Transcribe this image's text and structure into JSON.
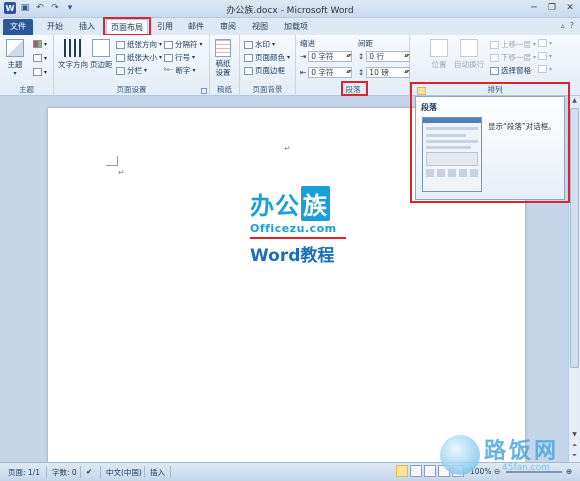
{
  "titlebar": {
    "title": "办公族.docx - Microsoft Word",
    "qat_icons": [
      "word-logo",
      "save-icon",
      "undo-icon",
      "redo-icon",
      "customize-icon"
    ],
    "window_controls": [
      "minimize",
      "restore",
      "close"
    ]
  },
  "tabs": [
    {
      "label": "文件",
      "style": "file"
    },
    {
      "label": "开始"
    },
    {
      "label": "插入"
    },
    {
      "label": "页面布局",
      "active": true,
      "highlighted": true
    },
    {
      "label": "引用"
    },
    {
      "label": "邮件"
    },
    {
      "label": "审阅"
    },
    {
      "label": "视图"
    },
    {
      "label": "加载项"
    }
  ],
  "ribbon": {
    "theme": {
      "label": "主题",
      "themes_button": "主题",
      "small_buttons": [
        "颜色",
        "字体",
        "效果"
      ]
    },
    "page_setup": {
      "label": "页面设置",
      "text_direction": "文字方向",
      "margins": "页边距",
      "orientation": "纸张方向",
      "size": "纸张大小",
      "columns": "分栏",
      "breaks": "分隔符",
      "line_numbers": "行号",
      "hyphenation": "断字"
    },
    "manuscript": {
      "label": "稿纸",
      "button": "稿纸\n设置"
    },
    "page_background": {
      "label": "页面背景",
      "watermark": "水印",
      "page_color": "页面颜色",
      "page_borders": "页面边框"
    },
    "paragraph": {
      "label": "段落",
      "indent_header": "缩进",
      "indent_left": "0 字符",
      "indent_right": "0 字符",
      "spacing_header": "间距",
      "spacing_before": "0 行",
      "spacing_after": "10 磅"
    },
    "arrange": {
      "label": "排列",
      "position": "位置",
      "wrap_text": "自动换行",
      "bring_forward": "上移一层",
      "send_backward": "下移一层",
      "selection_pane": "选择窗格"
    }
  },
  "tooltip": {
    "title": "段落",
    "description": "显示“段落”对话框。"
  },
  "document": {
    "logo_cn": "办公",
    "logo_cn_boxed": "族",
    "logo_url": "Officezu.com",
    "logo_word": "Word教程",
    "paragraph_mark": "↵"
  },
  "statusbar": {
    "page": "页面: 1/1",
    "words": "字数: 0",
    "language": "中文(中国)",
    "mode": "插入",
    "zoom": "100%"
  },
  "watermark_site": {
    "text": "路饭网",
    "url": "45fan.com"
  },
  "colors": {
    "accent": "#2b579a",
    "highlight_red": "#d9262c",
    "logo_blue": "#1aa0d8"
  }
}
